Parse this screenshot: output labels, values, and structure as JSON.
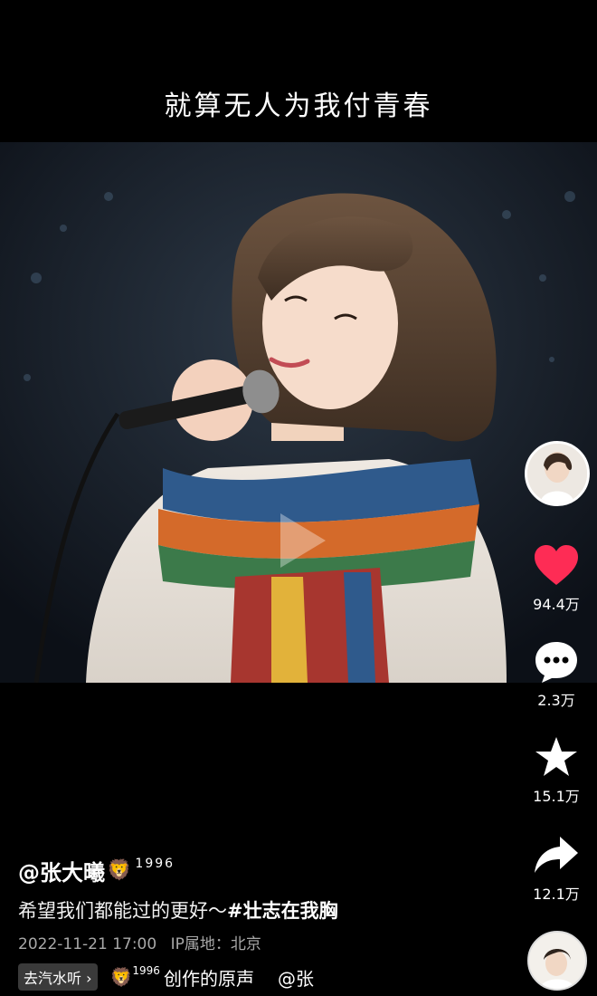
{
  "video": {
    "caption": "就算无人为我付青春"
  },
  "rail": {
    "like_count": "94.4万",
    "comment_count": "2.3万",
    "favorite_count": "15.1万",
    "share_count": "12.1万"
  },
  "post": {
    "author": "@张大曦",
    "author_emoji": "🦁",
    "author_tag": "1996",
    "description_text": "希望我们都能过的更好～",
    "description_hashtag": "#壮志在我胸",
    "date": "2022-11-21 17:00",
    "ip_location": "IP属地：北京"
  },
  "music": {
    "listen_button": "去汽水听 ›",
    "emoji": "🦁",
    "tag": "1996",
    "title": "创作的原声",
    "mention": "@张"
  },
  "colors": {
    "like": "#fe2c55",
    "background": "#000000",
    "meta_text": "#a8a8a8"
  }
}
